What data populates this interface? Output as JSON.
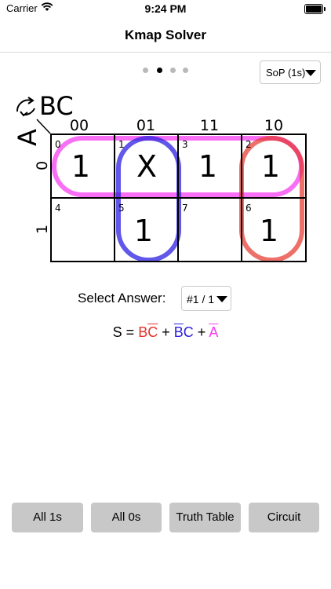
{
  "status_bar": {
    "carrier": "Carrier",
    "time": "9:24 PM"
  },
  "nav": {
    "title": "Kmap Solver"
  },
  "pager": {
    "count": 4,
    "active_index": 1
  },
  "mode_select": {
    "value": "SoP (1s)"
  },
  "kmap": {
    "row_var": "A",
    "col_var": "BC",
    "col_headers": [
      "00",
      "01",
      "11",
      "10"
    ],
    "row_headers": [
      "0",
      "1"
    ],
    "cells": [
      [
        {
          "index": "0",
          "value": "1"
        },
        {
          "index": "1",
          "value": "X"
        },
        {
          "index": "3",
          "value": "1"
        },
        {
          "index": "2",
          "value": "1"
        }
      ],
      [
        {
          "index": "4",
          "value": ""
        },
        {
          "index": "5",
          "value": "1"
        },
        {
          "index": "7",
          "value": ""
        },
        {
          "index": "6",
          "value": "1"
        }
      ]
    ],
    "group_colors": {
      "red": "#e5332a",
      "blue": "#2c1fe0",
      "pink": "#f53df2"
    }
  },
  "answer": {
    "label": "Select Answer:",
    "value": "#1 / 1",
    "equation": {
      "lhs": "S =",
      "terms": [
        {
          "a": "B",
          "b": "C",
          "color": "red"
        },
        {
          "a": "B",
          "b": "C",
          "color": "blue"
        },
        {
          "a": "A",
          "color": "pink"
        }
      ],
      "plus": "+"
    }
  },
  "buttons": {
    "all1": "All 1s",
    "all0": "All 0s",
    "truth": "Truth Table",
    "circuit": "Circuit"
  }
}
